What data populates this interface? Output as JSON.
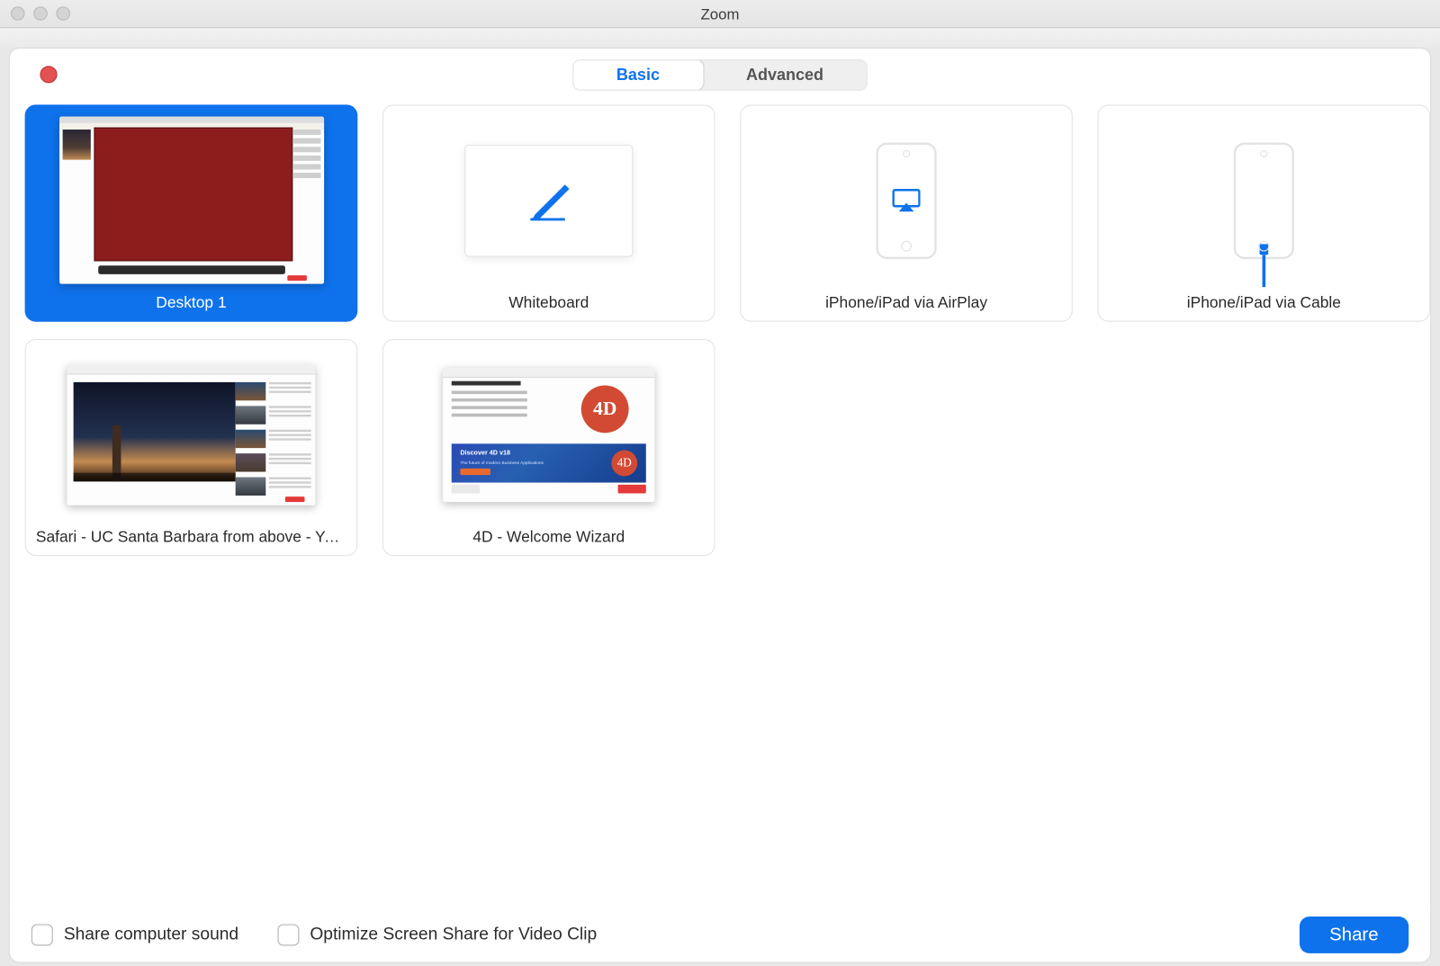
{
  "window": {
    "title": "Zoom"
  },
  "tabs": {
    "basic": "Basic",
    "advanced": "Advanced",
    "active": "basic"
  },
  "tiles": {
    "desktop1": {
      "label": "Desktop 1",
      "selected": true
    },
    "whiteboard": {
      "label": "Whiteboard"
    },
    "airplay": {
      "label": "iPhone/iPad via AirPlay"
    },
    "cable": {
      "label": "iPhone/iPad via Cable"
    },
    "safari": {
      "label": "Safari - UC Santa Barbara from above - Youtube"
    },
    "fourd": {
      "label": "4D - Welcome Wizard"
    }
  },
  "fourd_preview": {
    "logo_text": "4D",
    "band_title": "Discover 4D v18",
    "band_subtitle": "The future of modern Business Applications"
  },
  "footer": {
    "share_sound": "Share computer sound",
    "optimize": "Optimize Screen Share for Video Clip",
    "share_button": "Share"
  },
  "colors": {
    "accent": "#0e72ec",
    "close_dot": "#e35252"
  }
}
